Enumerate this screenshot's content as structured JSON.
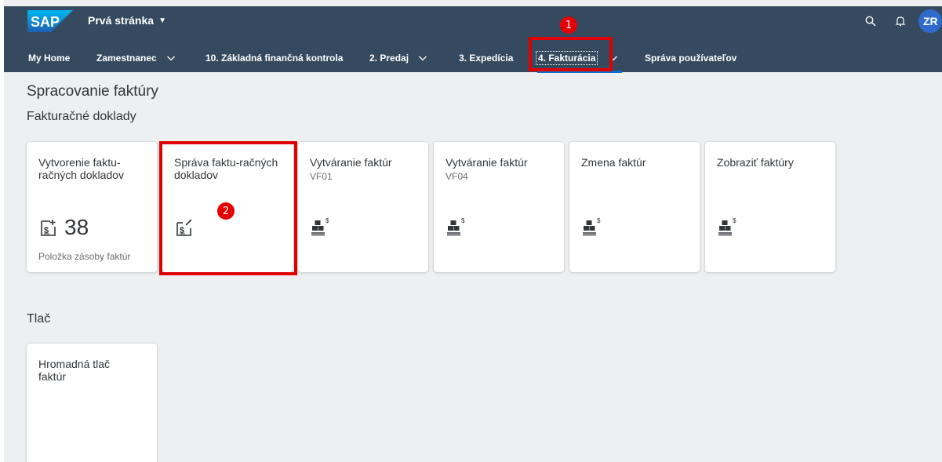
{
  "shell": {
    "logo_text": "SAP",
    "app_title": "Prvá stránka",
    "avatar_initials": "ZR",
    "icons": {
      "search": "search-icon",
      "notifications": "bell-icon",
      "title_caret": "caret-down-icon"
    }
  },
  "nav": {
    "items": [
      {
        "label": "My Home"
      },
      {
        "label": "Zamestnanec"
      },
      {
        "label": "10. Základná finančná kontrola"
      },
      {
        "label": "2. Predaj"
      },
      {
        "label": "3. Expedícia"
      },
      {
        "label": "4. Fakturácia"
      },
      {
        "label": "Správa používateľov"
      }
    ],
    "active_index": 5
  },
  "page": {
    "section_title": "Spracovanie faktúry",
    "groups": [
      {
        "title": "Fakturačné doklady",
        "tiles": [
          {
            "title": "Vytvorenie faktu-račných dokladov",
            "number": "38",
            "footer": "Položka zásoby faktúr",
            "icon": "document-add-icon"
          },
          {
            "title": "Správa faktu-račných dokladov",
            "icon": "document-edit-icon"
          },
          {
            "title": "Vytváranie faktúr",
            "subtitle": "VF01",
            "icon": "sap-gui-icon"
          },
          {
            "title": "Vytváranie faktúr",
            "subtitle": "VF04",
            "icon": "sap-gui-icon"
          },
          {
            "title": "Zmena faktúr",
            "icon": "sap-gui-icon"
          },
          {
            "title": "Zobraziť faktúry",
            "icon": "sap-gui-icon"
          }
        ]
      },
      {
        "title": "Tlač",
        "tiles": [
          {
            "title": "Hromadná tlač faktúr"
          }
        ]
      }
    ]
  },
  "annotations": [
    {
      "label": "1",
      "color": "#e40000"
    },
    {
      "label": "2",
      "color": "#e40000"
    }
  ]
}
